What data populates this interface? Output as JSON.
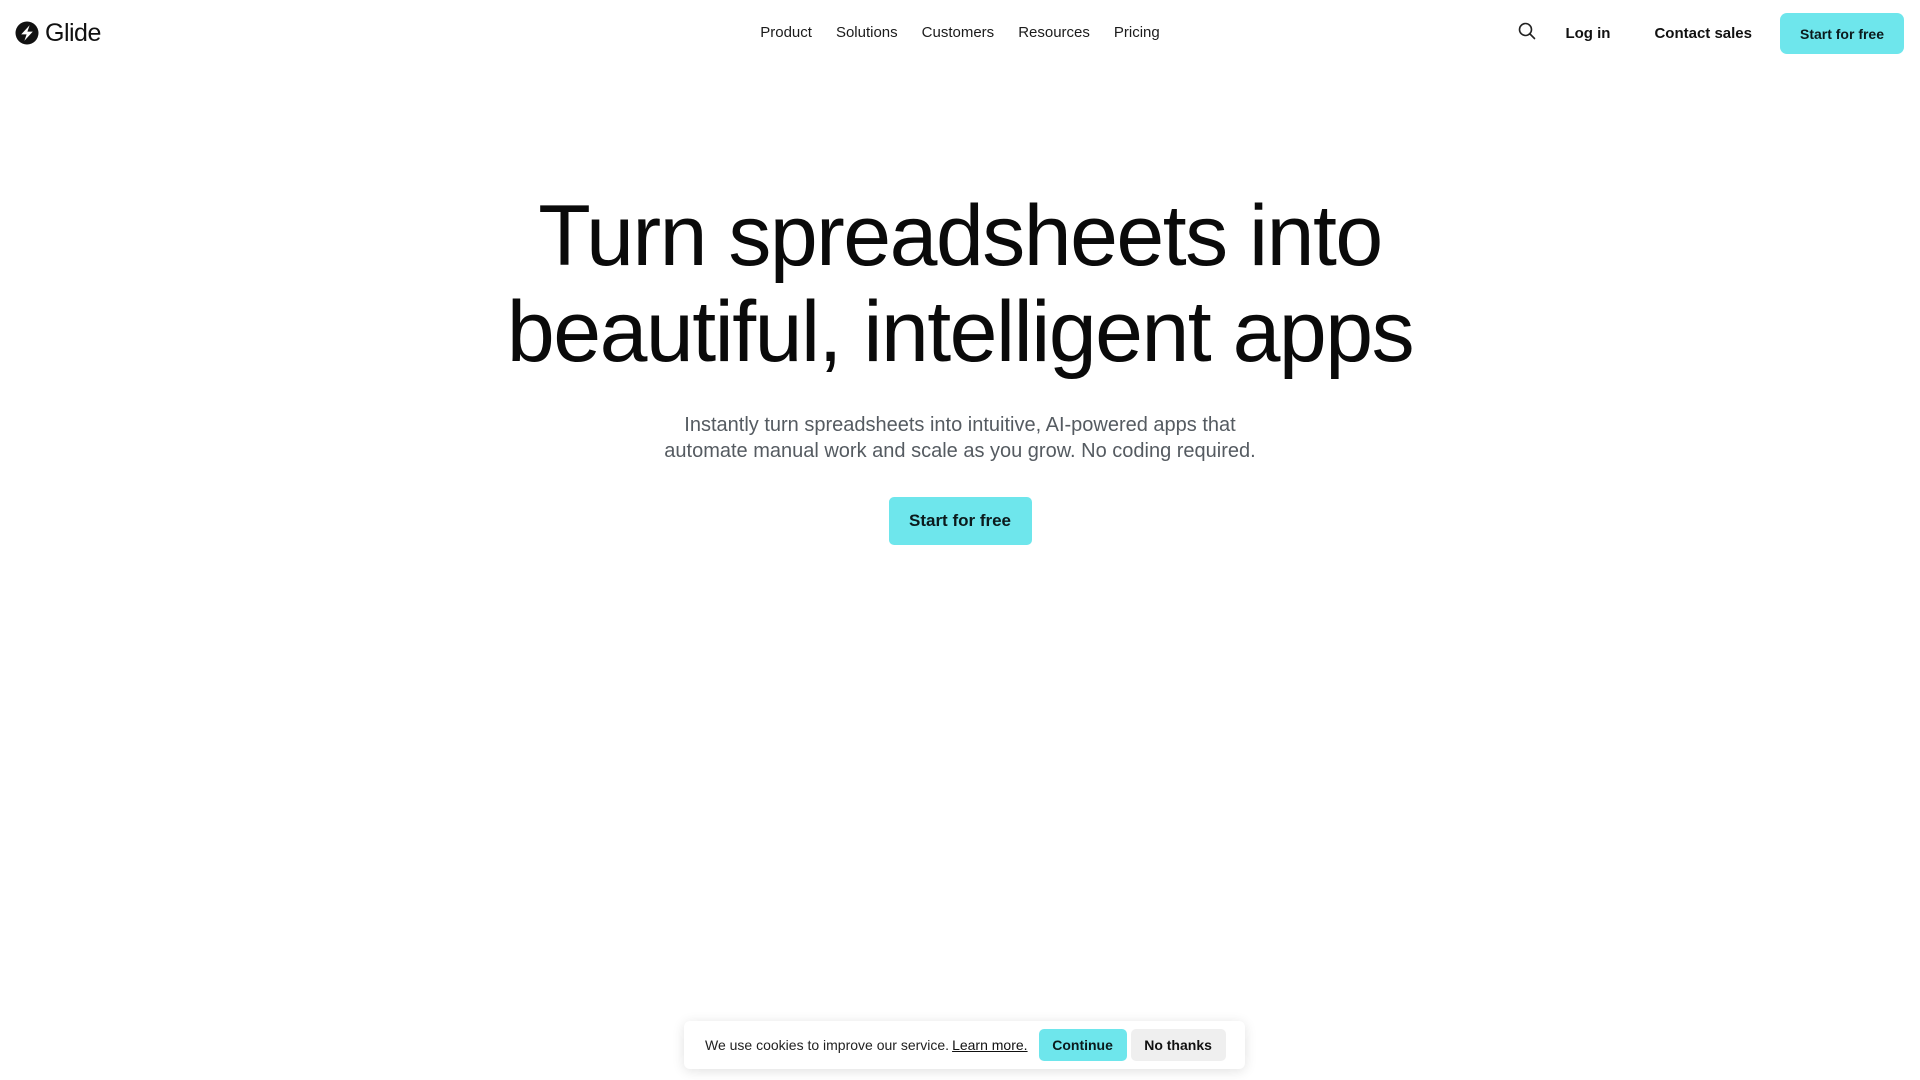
{
  "brand": {
    "name": "Glide",
    "logo_icon": "glide-bolt-icon"
  },
  "nav": {
    "items": [
      {
        "label": "Product"
      },
      {
        "label": "Solutions"
      },
      {
        "label": "Customers"
      },
      {
        "label": "Resources"
      },
      {
        "label": "Pricing"
      }
    ]
  },
  "header_actions": {
    "search_icon": "search-icon",
    "login_label": "Log in",
    "contact_label": "Contact sales",
    "start_label": "Start for free"
  },
  "hero": {
    "title_line1": "Turn spreadsheets into",
    "title_line2": "beautiful, intelligent apps",
    "subtitle_line1": "Instantly turn spreadsheets into intuitive, AI-powered apps that",
    "subtitle_line2": "automate manual work and scale as you grow. No coding required.",
    "cta_label": "Start for free"
  },
  "cookie_banner": {
    "message": "We use cookies to improve our service.",
    "link_label": "Learn more.",
    "accept_label": "Continue",
    "decline_label": "No thanks"
  },
  "colors": {
    "accent": "#6ee6ec",
    "text": "#0a0a0a",
    "muted": "#555b61",
    "decline_bg": "#efefef"
  }
}
